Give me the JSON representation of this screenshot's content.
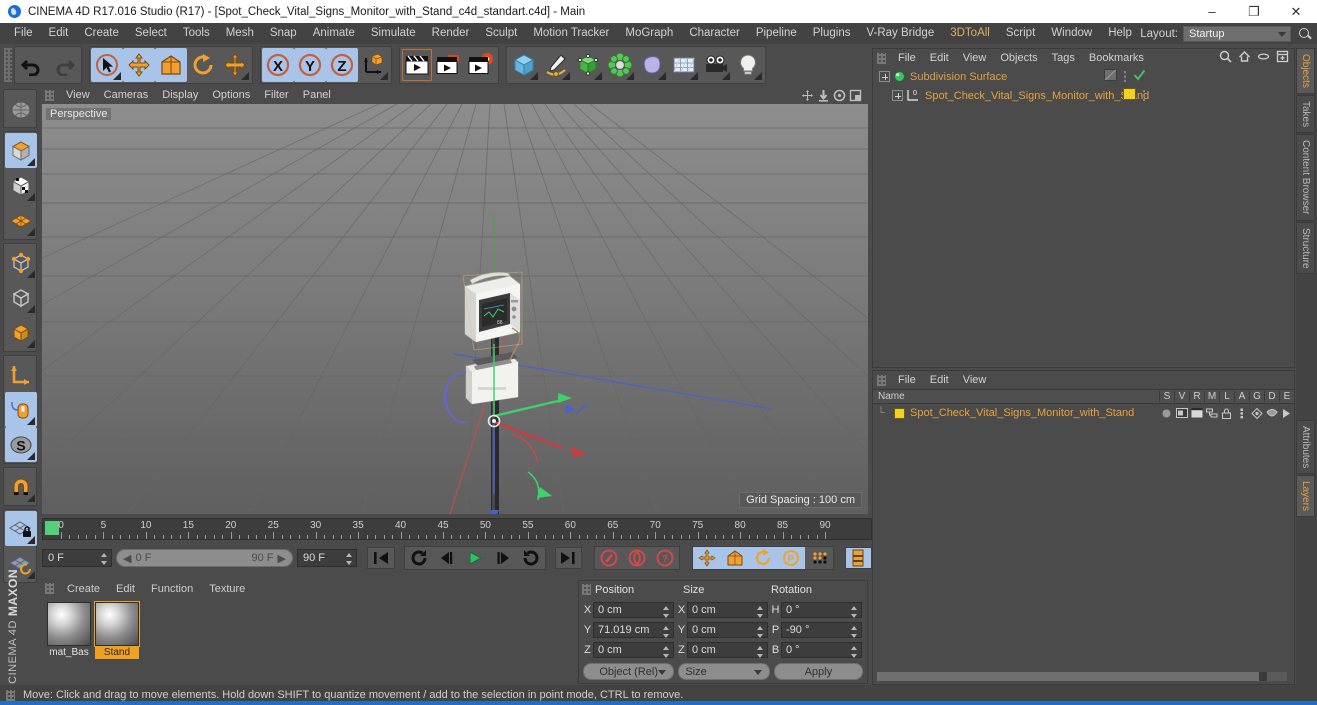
{
  "window": {
    "title": "CINEMA 4D R17.016 Studio (R17) - [Spot_Check_Vital_Signs_Monitor_with_Stand_c4d_standart.c4d] - Main",
    "minimize": "–",
    "maximize": "❐",
    "close": "✕"
  },
  "menubar": {
    "items": [
      {
        "label": "File"
      },
      {
        "label": "Edit"
      },
      {
        "label": "Create"
      },
      {
        "label": "Select"
      },
      {
        "label": "Tools"
      },
      {
        "label": "Mesh"
      },
      {
        "label": "Snap"
      },
      {
        "label": "Animate"
      },
      {
        "label": "Simulate"
      },
      {
        "label": "Render"
      },
      {
        "label": "Sculpt"
      },
      {
        "label": "Motion Tracker"
      },
      {
        "label": "MoGraph"
      },
      {
        "label": "Character"
      },
      {
        "label": "Pipeline"
      },
      {
        "label": "Plugins"
      },
      {
        "label": "V-Ray Bridge"
      },
      {
        "label": "3DToAll",
        "accent": true
      },
      {
        "label": "Script"
      },
      {
        "label": "Window"
      },
      {
        "label": "Help"
      }
    ],
    "layout_label": "Layout:",
    "layout_value": "Startup",
    "search_icon": "search-icon"
  },
  "toolbar": {
    "groups": [
      {
        "name": "history",
        "buttons": [
          {
            "icon": "undo-icon",
            "state": "normal"
          },
          {
            "icon": "redo-icon",
            "state": "disabled"
          }
        ]
      },
      {
        "name": "modes",
        "buttons": [
          {
            "icon": "select-live-icon",
            "state": "active"
          },
          {
            "icon": "move-icon",
            "state": "active"
          },
          {
            "icon": "scale-icon",
            "state": "normal"
          },
          {
            "icon": "rotate-icon",
            "state": "normal"
          },
          {
            "icon": "move-alt-icon",
            "state": "normal"
          }
        ]
      },
      {
        "name": "axes",
        "buttons": [
          {
            "icon": "axis-x-icon",
            "state": "active",
            "label": "X"
          },
          {
            "icon": "axis-y-icon",
            "state": "active",
            "label": "Y"
          },
          {
            "icon": "axis-z-icon",
            "state": "active",
            "label": "Z"
          },
          {
            "icon": "world-object-axis-icon",
            "state": "normal"
          }
        ]
      },
      {
        "name": "render",
        "buttons": [
          {
            "icon": "render-view-icon",
            "state": "normal"
          },
          {
            "icon": "render-region-icon",
            "state": "normal"
          },
          {
            "icon": "render-settings-icon",
            "state": "normal"
          }
        ]
      },
      {
        "name": "create",
        "buttons": [
          {
            "icon": "cube-primitive-icon",
            "state": "normal"
          },
          {
            "icon": "spline-pen-icon",
            "state": "normal"
          },
          {
            "icon": "generator-icon",
            "state": "normal"
          },
          {
            "icon": "mograph-array-icon",
            "state": "normal"
          },
          {
            "icon": "deformer-icon",
            "state": "normal"
          },
          {
            "icon": "scene-floor-icon",
            "state": "normal"
          },
          {
            "icon": "camera-icon",
            "state": "normal"
          },
          {
            "icon": "light-icon",
            "state": "normal"
          }
        ]
      }
    ]
  },
  "left_toolbar": {
    "buttons": [
      {
        "icon": "viewport-navigation-icon",
        "state": "normal"
      },
      {
        "icon": "make-editable-icon",
        "state": "active"
      },
      {
        "icon": "texture-axis-mode-icon",
        "state": "normal"
      },
      {
        "icon": "polygon-grid-icon",
        "state": "normal"
      },
      {
        "icon": "point-mode-icon",
        "state": "normal"
      },
      {
        "icon": "edge-mode-icon",
        "state": "normal"
      },
      {
        "icon": "polygon-mode-icon",
        "state": "normal"
      },
      {
        "icon": "object-axis-icon",
        "state": "normal"
      },
      {
        "icon": "viewport-solo-icon",
        "state": "active"
      },
      {
        "icon": "soft-selection-icon",
        "state": "active"
      },
      {
        "icon": "magnet-icon",
        "state": "normal"
      },
      {
        "icon": "workplane-lock-icon",
        "state": "active"
      },
      {
        "icon": "workplane-rotate-icon",
        "state": "normal"
      }
    ],
    "brand_top": "MAXON",
    "brand_bottom": "CINEMA 4D"
  },
  "viewport": {
    "menu": [
      "View",
      "Cameras",
      "Display",
      "Options",
      "Filter",
      "Panel"
    ],
    "corner_icons": [
      "pan-icon",
      "zoom-icon",
      "rotate-view-icon",
      "maximize-view-icon"
    ],
    "label": "Perspective",
    "grid_spacing": "Grid Spacing : 100 cm",
    "axis_hud": {
      "x": "X",
      "y": "Y",
      "z": "Z"
    }
  },
  "timeline": {
    "ruler_min": 0,
    "ruler_max": 90,
    "tick_labels": [
      "0",
      "5",
      "10",
      "15",
      "20",
      "25",
      "30",
      "35",
      "40",
      "45",
      "50",
      "55",
      "60",
      "65",
      "70",
      "75",
      "80",
      "85",
      "90"
    ],
    "playhead_frame": "0 F",
    "current_frame": "0 F",
    "range_start": "0 F",
    "range_end": "90 F",
    "end_frame": "90 F",
    "transport": [
      {
        "icon": "go-to-start-icon"
      },
      {
        "icon": "play-backwards-loop-icon"
      },
      {
        "icon": "step-back-icon"
      },
      {
        "icon": "play-icon"
      },
      {
        "icon": "step-forward-icon"
      },
      {
        "icon": "loop-icon"
      },
      {
        "icon": "go-to-end-icon"
      }
    ],
    "record_group": [
      {
        "icon": "record-key-icon"
      },
      {
        "icon": "autokeying-icon"
      },
      {
        "icon": "keyframe-selection-icon"
      }
    ],
    "key_group": [
      {
        "icon": "key-position-icon",
        "state": "active"
      },
      {
        "icon": "key-scale-icon",
        "state": "active"
      },
      {
        "icon": "key-rotation-icon",
        "state": "active"
      },
      {
        "icon": "key-parameter-icon",
        "state": "active"
      },
      {
        "icon": "key-pla-icon",
        "state": "normal"
      }
    ],
    "extra": {
      "icon": "timeline-layout-icon",
      "state": "active"
    }
  },
  "material_manager": {
    "menu": [
      "Create",
      "Edit",
      "Function",
      "Texture"
    ],
    "materials": [
      {
        "name": "mat_Bas",
        "selected": false
      },
      {
        "name": "Stand",
        "selected": true
      }
    ]
  },
  "coordinates": {
    "headers": [
      "Position",
      "Size",
      "Rotation"
    ],
    "rows": [
      {
        "pos_axis": "X",
        "pos": "0 cm",
        "size_axis": "X",
        "size": "0 cm",
        "rot_axis": "H",
        "rot": "0 °"
      },
      {
        "pos_axis": "Y",
        "pos": "71.019 cm",
        "size_axis": "Y",
        "size": "0 cm",
        "rot_axis": "P",
        "rot": "-90 °"
      },
      {
        "pos_axis": "Z",
        "pos": "0 cm",
        "size_axis": "Z",
        "size": "0 cm",
        "rot_axis": "B",
        "rot": "0 °"
      }
    ],
    "mode_label": "Object (Rel)",
    "size_label": "Size",
    "apply_label": "Apply"
  },
  "object_manager": {
    "menu": [
      "File",
      "Edit",
      "View",
      "Objects",
      "Tags",
      "Bookmarks"
    ],
    "header_icons": [
      "search-icon",
      "home-icon",
      "link-icon",
      "add-layer-icon"
    ],
    "rows": [
      {
        "name": "Subdivision Surface",
        "depth": 0,
        "color": "#d8a24a",
        "dot": "green-dot-icon",
        "tags": [
          "hidden-strip-icon",
          "visibility-dots-icon",
          "check-icon"
        ]
      },
      {
        "name": "Spot_Check_Vital_Signs_Monitor_with_Stand",
        "depth": 1,
        "color": "#e8a33d",
        "dot": "polygon-object-icon",
        "tags": [
          "yellow-swatch-icon",
          "visibility-dots-icon"
        ]
      }
    ]
  },
  "layer_manager": {
    "menu": [
      "File",
      "Edit",
      "View"
    ],
    "columns": [
      "Name",
      "S",
      "V",
      "R",
      "M",
      "L",
      "A",
      "G",
      "D",
      "E"
    ],
    "rows": [
      {
        "name": "Spot_Check_Vital_Signs_Monitor_with_Stand",
        "swatch": "#f2d024",
        "cells": [
          "solo-dot-icon",
          "view-icon",
          "render-icon",
          "manager-icon",
          "lock-icon",
          "animation-icon",
          "generator-icon",
          "deformer-icon",
          "expression-icon"
        ]
      }
    ]
  },
  "right_tabs": {
    "top": [
      {
        "label": "Objects",
        "active": true
      },
      {
        "label": "Takes",
        "active": false
      },
      {
        "label": "Content Browser",
        "active": false
      },
      {
        "label": "Structure",
        "active": false
      }
    ],
    "bottom": [
      {
        "label": "Attributes",
        "active": false
      },
      {
        "label": "Layers",
        "active": true
      }
    ]
  },
  "statusbar": {
    "message": "Move: Click and drag to move elements. Hold down SHIFT to quantize movement / add to the selection in point mode, CTRL to remove."
  }
}
